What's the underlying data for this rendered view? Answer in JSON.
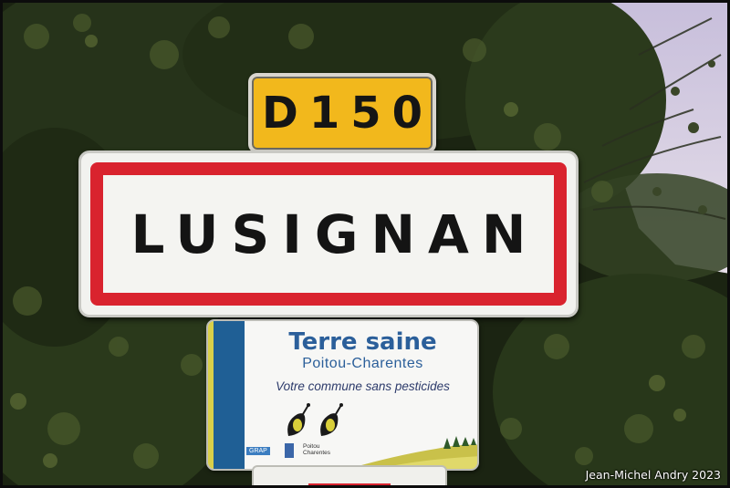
{
  "road_number": {
    "text": "D150"
  },
  "town_sign": {
    "name": "LUSIGNAN"
  },
  "eco_panel": {
    "title": "Terre saine",
    "region": "Poitou-Charentes",
    "tagline": "Votre commune sans pesticides",
    "logo_texts": [
      "GRAP",
      "Poitou Charentes"
    ]
  },
  "credit": "Jean-Michel Andry 2023",
  "colors": {
    "road_plate": "#f2b81c",
    "town_border": "#d9232e",
    "eco_blue": "#2b5f9a",
    "foliage": "#1e2a14",
    "sky": "#d9cfe6"
  },
  "icons": [
    "butterfly-icon",
    "butterfly-icon",
    "landscape-icon"
  ]
}
